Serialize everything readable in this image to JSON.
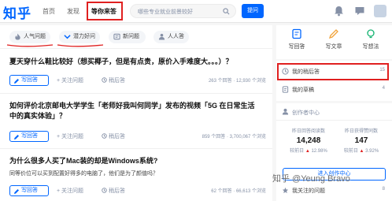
{
  "header": {
    "logo": "知乎",
    "nav": [
      "首页",
      "发现",
      "等你来答"
    ],
    "search_placeholder": "哪些专业就业前景较好",
    "ask_label": "提问"
  },
  "feed": {
    "tabs": [
      {
        "label": "人气问题",
        "icon": "hot-icon"
      },
      {
        "label": "潜力好问",
        "icon": "potential-icon"
      },
      {
        "label": "新问题",
        "icon": "new-icon"
      },
      {
        "label": "人人答",
        "icon": "people-icon"
      }
    ],
    "questions": [
      {
        "title_lines": [
          "夏天穿什么鞋比较好（想买椰子，但是有点贵，原价入手难度大。。。）？"
        ],
        "excerpt": "",
        "stats": "263 个回答 · 12,930 个浏览"
      },
      {
        "title_lines": [
          "如何评价北京邮电大学学生「老师好我叫何同学」发布的视频「5G 在日常生活",
          "中的真实体验」？"
        ],
        "excerpt": "",
        "stats": "859 个回答 · 3,700,067 个浏览"
      },
      {
        "title_lines": [
          "为什么很多人买了Mac装的却是Windows系统?"
        ],
        "excerpt": "同等价位可以买到配置好得多的电脑了，他们是为了颜值吗？",
        "stats": "62 个回答 · 66,613 个浏览"
      }
    ],
    "actions": {
      "write": "写回答",
      "follow": "+ 关注问题",
      "later": "稍后答"
    }
  },
  "sidebar": {
    "tools": [
      "写回答",
      "写文章",
      "写想法"
    ],
    "list": [
      {
        "label": "我的稍后答",
        "count": "15",
        "icon": "clock-icon"
      },
      {
        "label": "我的草稿",
        "count": "4",
        "icon": "draft-icon"
      }
    ],
    "creator": {
      "title": "创作者中心",
      "stats": [
        {
          "label": "昨日回答阅读数",
          "value": "14,248",
          "delta_label": "较前日",
          "delta": "12.98%"
        },
        {
          "label": "昨日获得赞同数",
          "value": "147",
          "delta_label": "较前日",
          "delta": "3.92%"
        }
      ],
      "button": "进入创作中心"
    },
    "bottom": [
      {
        "label": "我关注的问题",
        "count": "8",
        "icon": "follow-icon"
      },
      {
        "label": "我关注的收藏",
        "count": "",
        "icon": "star-icon"
      }
    ]
  },
  "watermark": "知乎 @Yeung Bravo",
  "colors": {
    "brand": "#0066ff",
    "highlight": "#e02020"
  }
}
